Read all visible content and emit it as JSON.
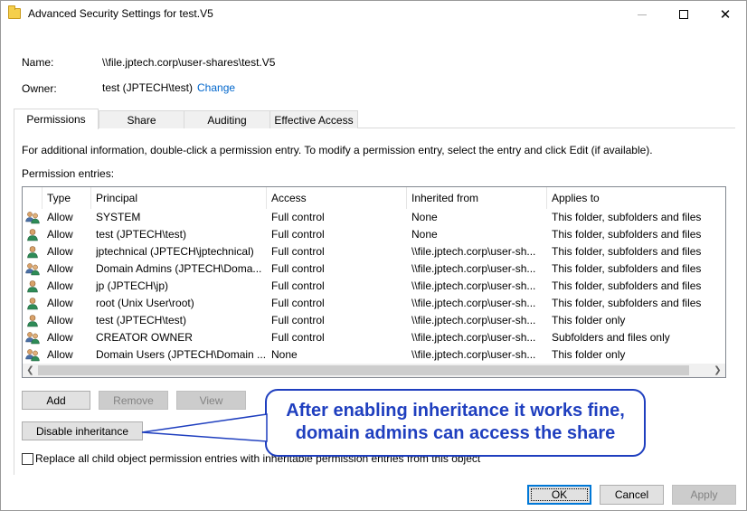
{
  "window": {
    "title": "Advanced Security Settings for test.V5"
  },
  "fields": {
    "name_label": "Name:",
    "name_value": "\\\\file.jptech.corp\\user-shares\\test.V5",
    "owner_label": "Owner:",
    "owner_value": "test (JPTECH\\test)",
    "change_link": "Change"
  },
  "tabs": [
    {
      "label": "Permissions",
      "active": true
    },
    {
      "label": "Share",
      "active": false
    },
    {
      "label": "Auditing",
      "active": false
    },
    {
      "label": "Effective Access",
      "active": false
    }
  ],
  "panel": {
    "info_text": "For additional information, double-click a permission entry. To modify a permission entry, select the entry and click Edit (if available).",
    "entries_label": "Permission entries:"
  },
  "table": {
    "columns": [
      "Type",
      "Principal",
      "Access",
      "Inherited from",
      "Applies to"
    ],
    "rows": [
      {
        "icon": "group-icon",
        "type": "Allow",
        "principal": "SYSTEM",
        "access": "Full control",
        "inherited": "None",
        "applies": "This folder, subfolders and files"
      },
      {
        "icon": "user-icon",
        "type": "Allow",
        "principal": "test (JPTECH\\test)",
        "access": "Full control",
        "inherited": "None",
        "applies": "This folder, subfolders and files"
      },
      {
        "icon": "user-icon",
        "type": "Allow",
        "principal": "jptechnical (JPTECH\\jptechnical)",
        "access": "Full control",
        "inherited": "\\\\file.jptech.corp\\user-sh...",
        "applies": "This folder, subfolders and files"
      },
      {
        "icon": "group-icon",
        "type": "Allow",
        "principal": "Domain Admins (JPTECH\\Doma...",
        "access": "Full control",
        "inherited": "\\\\file.jptech.corp\\user-sh...",
        "applies": "This folder, subfolders and files"
      },
      {
        "icon": "user-icon",
        "type": "Allow",
        "principal": "jp (JPTECH\\jp)",
        "access": "Full control",
        "inherited": "\\\\file.jptech.corp\\user-sh...",
        "applies": "This folder, subfolders and files"
      },
      {
        "icon": "user-icon",
        "type": "Allow",
        "principal": "root (Unix User\\root)",
        "access": "Full control",
        "inherited": "\\\\file.jptech.corp\\user-sh...",
        "applies": "This folder, subfolders and files"
      },
      {
        "icon": "user-icon",
        "type": "Allow",
        "principal": "test (JPTECH\\test)",
        "access": "Full control",
        "inherited": "\\\\file.jptech.corp\\user-sh...",
        "applies": "This folder only"
      },
      {
        "icon": "group-icon",
        "type": "Allow",
        "principal": "CREATOR OWNER",
        "access": "Full control",
        "inherited": "\\\\file.jptech.corp\\user-sh...",
        "applies": "Subfolders and files only"
      },
      {
        "icon": "group-icon",
        "type": "Allow",
        "principal": "Domain Users (JPTECH\\Domain ...",
        "access": "None",
        "inherited": "\\\\file.jptech.corp\\user-sh...",
        "applies": "This folder only"
      }
    ]
  },
  "buttons": {
    "add": "Add",
    "remove": "Remove",
    "view": "View",
    "disable_inheritance": "Disable inheritance",
    "ok": "OK",
    "cancel": "Cancel",
    "apply": "Apply"
  },
  "checkbox": {
    "label": "Replace all child object permission entries with inheritable permission entries from this object",
    "checked": false
  },
  "callout": {
    "line1": "After enabling inheritance it works fine,",
    "line2": "domain admins can access the share"
  },
  "colors": {
    "callout": "#1f3fbf",
    "link": "#0066cc",
    "default_button_border": "#0078d7"
  }
}
